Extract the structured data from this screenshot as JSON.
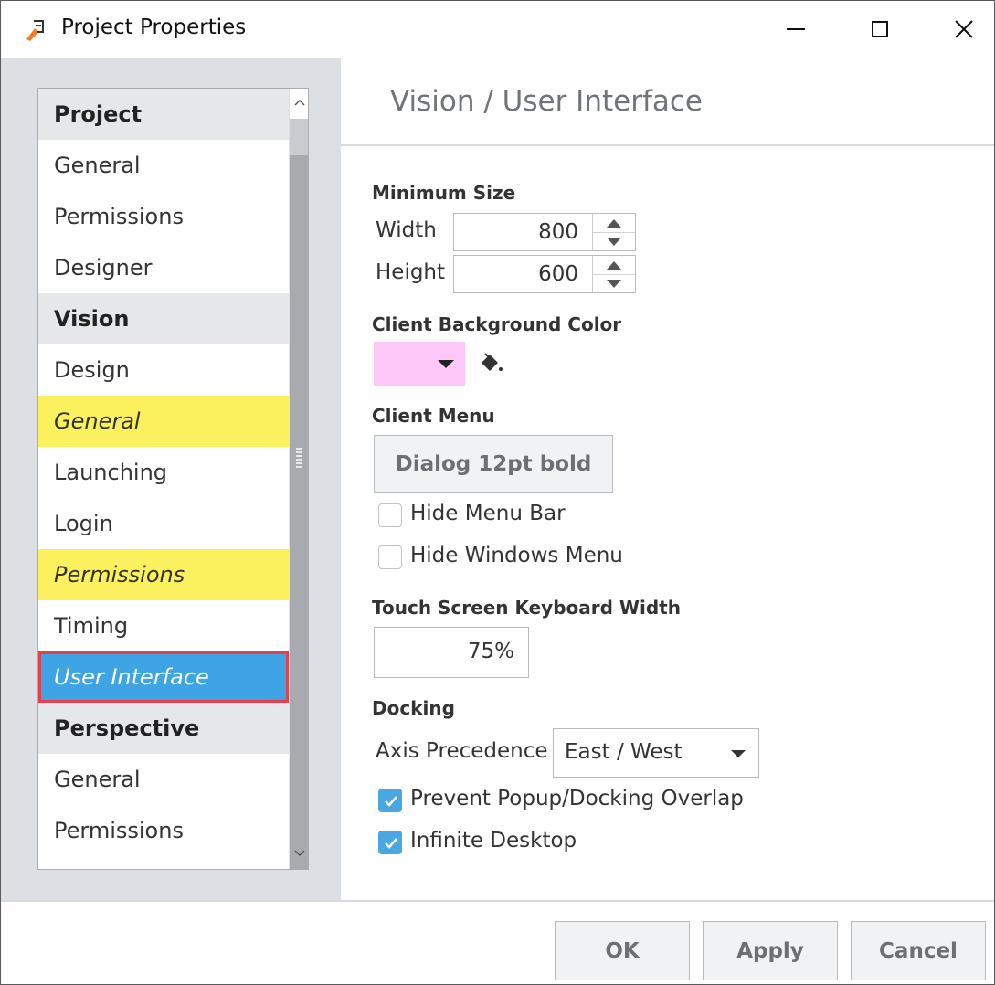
{
  "window": {
    "title": "Project Properties",
    "controls": {
      "minimize_icon": "minimize-icon",
      "maximize_icon": "maximize-icon",
      "close_glyph": "✕"
    }
  },
  "sidebar": {
    "items": [
      {
        "label": "Project",
        "type": "header"
      },
      {
        "label": "General",
        "type": "item"
      },
      {
        "label": "Permissions",
        "type": "item"
      },
      {
        "label": "Designer",
        "type": "item"
      },
      {
        "label": "Vision",
        "type": "header"
      },
      {
        "label": "Design",
        "type": "item"
      },
      {
        "label": "General",
        "type": "modified"
      },
      {
        "label": "Launching",
        "type": "item"
      },
      {
        "label": "Login",
        "type": "item"
      },
      {
        "label": "Permissions",
        "type": "modified"
      },
      {
        "label": "Timing",
        "type": "item"
      },
      {
        "label": "User Interface",
        "type": "selected"
      },
      {
        "label": "Perspective",
        "type": "header"
      },
      {
        "label": "General",
        "type": "item"
      },
      {
        "label": "Permissions",
        "type": "item"
      }
    ],
    "scroll_up_glyph": "^",
    "scroll_down_glyph": "v",
    "colors": {
      "header_bg": "#e6e7ea",
      "modified_bg": "#fbf05d",
      "selected_bg": "#3ea4e3",
      "selected_outline": "#e8404a"
    }
  },
  "main": {
    "section_title": "Vision / User Interface",
    "minimum_size": {
      "label": "Minimum Size",
      "width_label": "Width",
      "width_value": "800",
      "height_label": "Height",
      "height_value": "600"
    },
    "background_color": {
      "label": "Client Background Color",
      "swatch_color": "#fec9f8",
      "picker_icon": "paint-bucket-icon"
    },
    "client_menu": {
      "label": "Client Menu",
      "font_button": "Dialog 12pt bold",
      "hide_menu_bar": {
        "label": "Hide Menu Bar",
        "checked": false
      },
      "hide_windows_menu": {
        "label": "Hide Windows Menu",
        "checked": false
      }
    },
    "keyboard": {
      "label": "Touch Screen Keyboard Width",
      "value": "75%"
    },
    "docking": {
      "label": "Docking",
      "axis_label": "Axis Precedence",
      "axis_value": "East / West",
      "prevent_overlap": {
        "label": "Prevent Popup/Docking Overlap",
        "checked": true
      },
      "infinite_desktop": {
        "label": "Infinite Desktop",
        "checked": true
      }
    }
  },
  "footer": {
    "ok": "OK",
    "apply": "Apply",
    "cancel": "Cancel"
  }
}
